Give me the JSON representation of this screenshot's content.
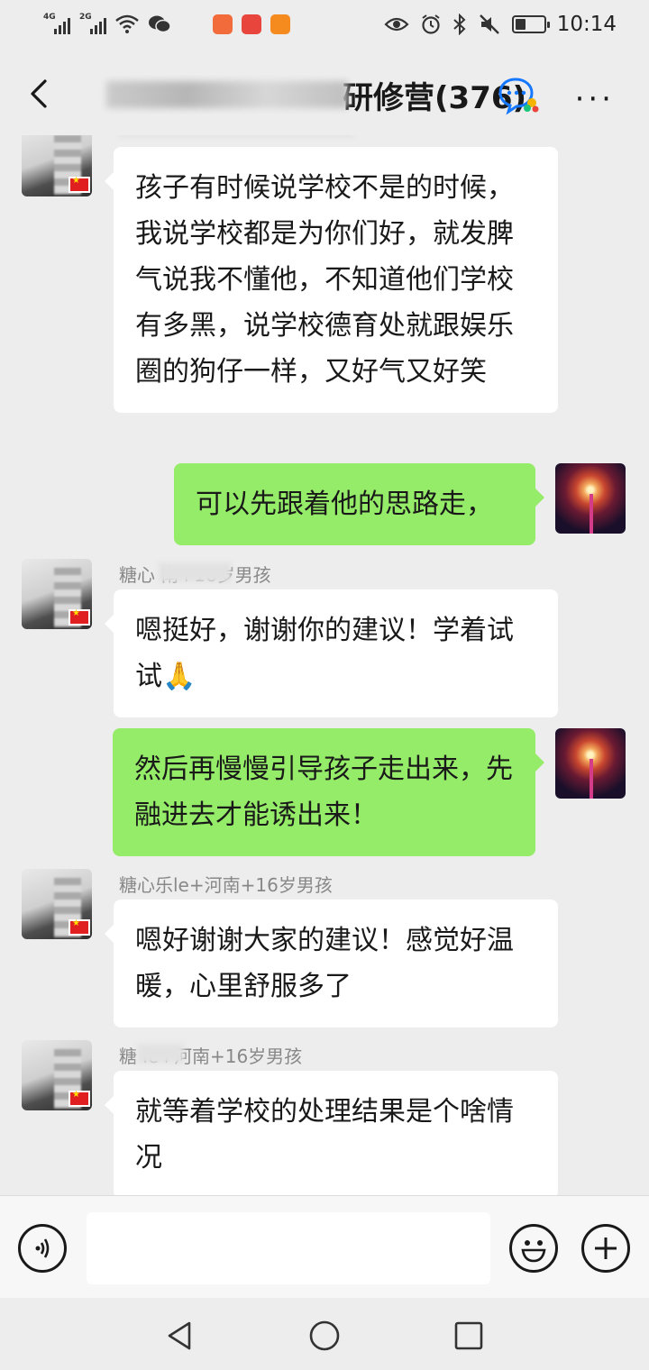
{
  "status_bar": {
    "network_1": "4G",
    "network_2": "2G",
    "time": "10:14",
    "battery_level": 0.35
  },
  "header": {
    "title_visible": "研修营(376)",
    "icons": [
      "back-arrow-icon",
      "group-chat-icon",
      "more-icon"
    ]
  },
  "colors": {
    "background": "#ededed",
    "incoming_bubble": "#ffffff",
    "outgoing_bubble": "#95ec69",
    "nickname": "#888888"
  },
  "messages": [
    {
      "direction": "incoming",
      "nickname": "",
      "text": "孩子有时候说学校不是的时候，我说学校都是为你们好，就发脾气说我不懂他，不知道他们学校有多黑，说学校德育处就跟娱乐圈的狗仔一样，又好气又好笑"
    },
    {
      "direction": "outgoing",
      "text": "可以先跟着他的思路走，"
    },
    {
      "direction": "incoming",
      "nickname": "糖心 南+16岁男孩",
      "text": "嗯挺好，谢谢你的建议！学着试试🙏"
    },
    {
      "direction": "outgoing",
      "text": "然后再慢慢引导孩子走出来，先融进去才能诱出来！"
    },
    {
      "direction": "incoming",
      "nickname": "糖心乐le+河南+16岁男孩",
      "text": "嗯好谢谢大家的建议！感觉好温暖，心里舒服多了"
    },
    {
      "direction": "incoming",
      "nickname": "糖 le+河南+16岁男孩",
      "text": "就等着学校的处理结果是个啥情况"
    }
  ],
  "input_bar": {
    "placeholder": "",
    "icons": [
      "voice-icon",
      "emoji-icon",
      "plus-icon"
    ]
  },
  "nav_bar": {
    "icons": [
      "back-triangle-icon",
      "home-circle-icon",
      "recents-square-icon"
    ]
  }
}
